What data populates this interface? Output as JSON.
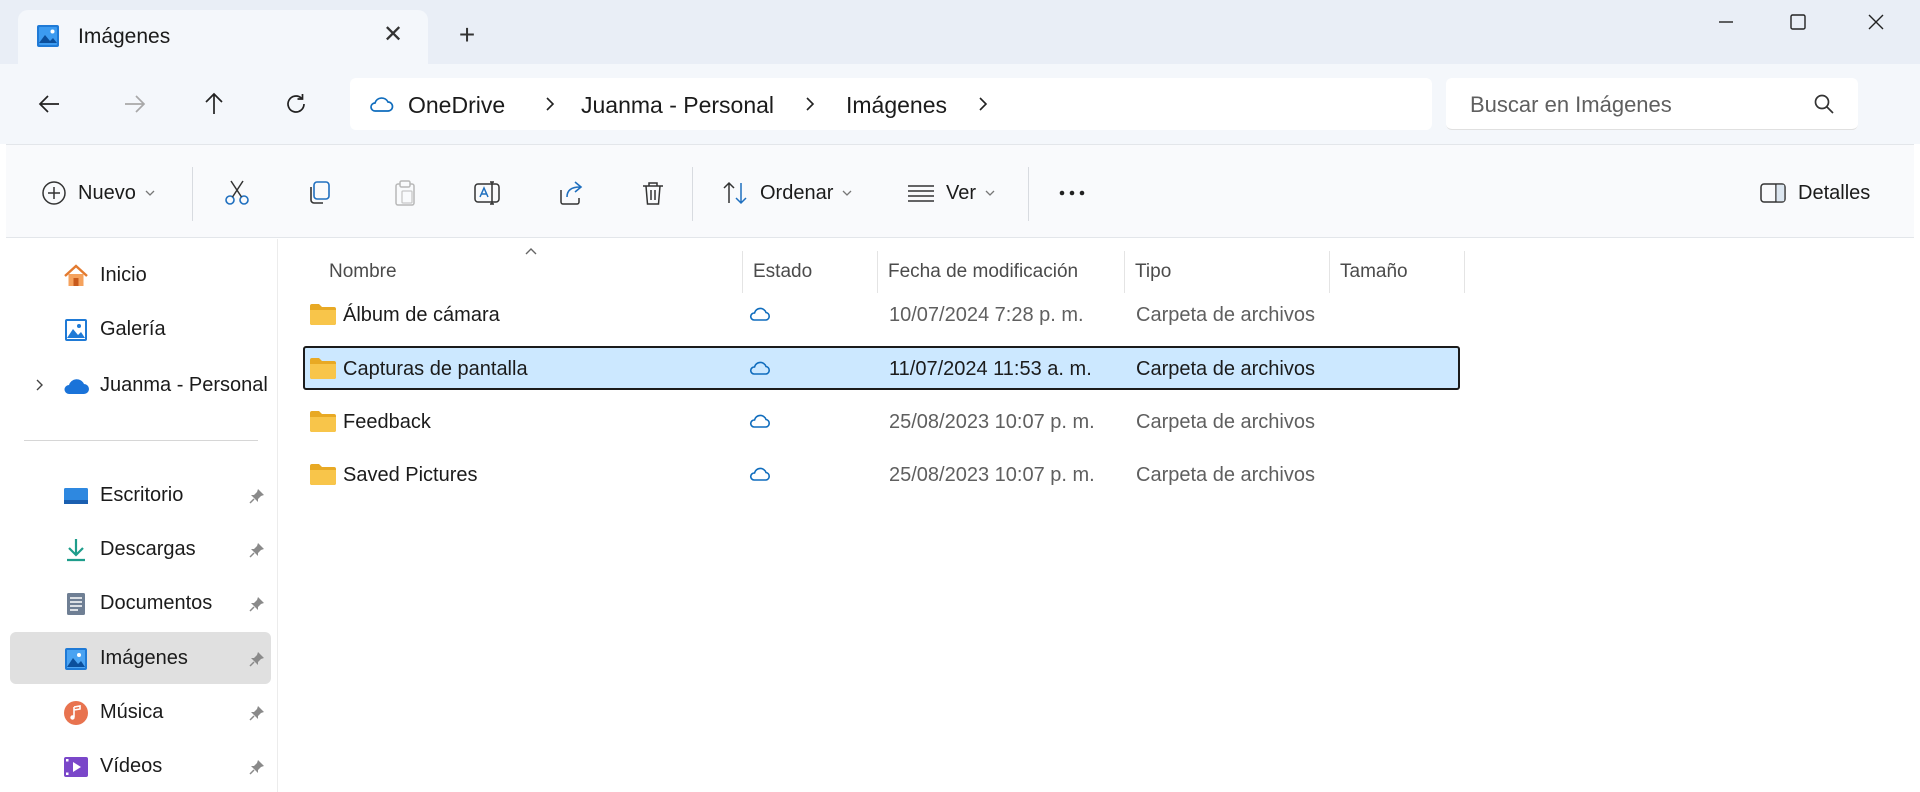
{
  "window": {
    "tab_title": "Imágenes",
    "new_tab_symbol": "+",
    "close_tab_symbol": "✕"
  },
  "address_bar": {
    "breadcrumbs": [
      "OneDrive",
      "Juanma - Personal",
      "Imágenes"
    ],
    "search_placeholder": "Buscar en Imágenes"
  },
  "command_bar": {
    "new_label": "Nuevo",
    "sort_label": "Ordenar",
    "view_label": "Ver",
    "details_label": "Detalles",
    "more_symbol": "···"
  },
  "sidebar": {
    "top_items": [
      {
        "label": "Inicio",
        "icon": "home-icon"
      },
      {
        "label": "Galería",
        "icon": "gallery-icon"
      },
      {
        "label": "Juanma - Personal",
        "icon": "onedrive-cloud-icon"
      }
    ],
    "quick_access": [
      {
        "label": "Escritorio",
        "icon": "desktop-icon",
        "pinned": true
      },
      {
        "label": "Descargas",
        "icon": "downloads-icon",
        "pinned": true
      },
      {
        "label": "Documentos",
        "icon": "documents-icon",
        "pinned": true
      },
      {
        "label": "Imágenes",
        "icon": "pictures-icon",
        "pinned": true,
        "selected": true
      },
      {
        "label": "Música",
        "icon": "music-icon",
        "pinned": true
      },
      {
        "label": "Vídeos",
        "icon": "videos-icon",
        "pinned": true
      }
    ]
  },
  "file_list": {
    "columns": [
      "Nombre",
      "Estado",
      "Fecha de modificación",
      "Tipo",
      "Tamaño"
    ],
    "rows": [
      {
        "name": "Álbum de cámara",
        "status": "cloud-icon",
        "modified": "10/07/2024 7:28 p. m.",
        "type": "Carpeta de archivos",
        "size": ""
      },
      {
        "name": "Capturas de pantalla",
        "status": "cloud-icon",
        "modified": "11/07/2024 11:53 a. m.",
        "type": "Carpeta de archivos",
        "size": "",
        "selected": true
      },
      {
        "name": "Feedback",
        "status": "cloud-icon",
        "modified": "25/08/2023 10:07 p. m.",
        "type": "Carpeta de archivos",
        "size": ""
      },
      {
        "name": "Saved Pictures",
        "status": "cloud-icon",
        "modified": "25/08/2023 10:07 p. m.",
        "type": "Carpeta de archivos",
        "size": ""
      }
    ]
  },
  "colors": {
    "titlebar_bg": "#e9eef6",
    "selection_bg": "#cce8ff",
    "accent": "#0078d4",
    "folder": "#f8c54a"
  }
}
